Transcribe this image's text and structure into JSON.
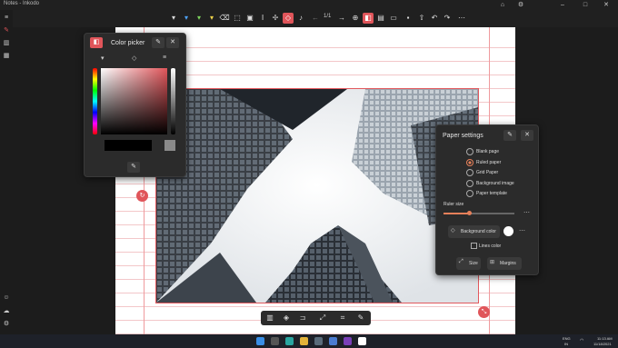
{
  "app": {
    "title": "Notes - Inkodo"
  },
  "toolbar": {
    "page_indicator": "1/1"
  },
  "color_picker": {
    "title": "Color picker"
  },
  "paper_settings": {
    "title": "Paper settings",
    "options": [
      "Blank page",
      "Ruled paper",
      "Grid Paper",
      "Background image",
      "Paper template"
    ],
    "selected_option": "Ruled paper",
    "ruler_size_label": "Ruler size",
    "ruler_size_level": 0.36,
    "background_color_label": "Background color",
    "lines_color_label": "Lines color",
    "size_label": "Size",
    "margins_label": "Margins"
  },
  "taskbar": {
    "language": "ENG",
    "region": "IN",
    "time": "11:13 AM",
    "date": "11/18/2021"
  },
  "colors": {
    "accent": "#e0555a",
    "canvas": "#ffffff",
    "rule_line": "#f3c7c9",
    "margin_line": "#ef9a9d",
    "panel_bg": "#2b2b2b",
    "selected_radio": "#e6805a"
  }
}
